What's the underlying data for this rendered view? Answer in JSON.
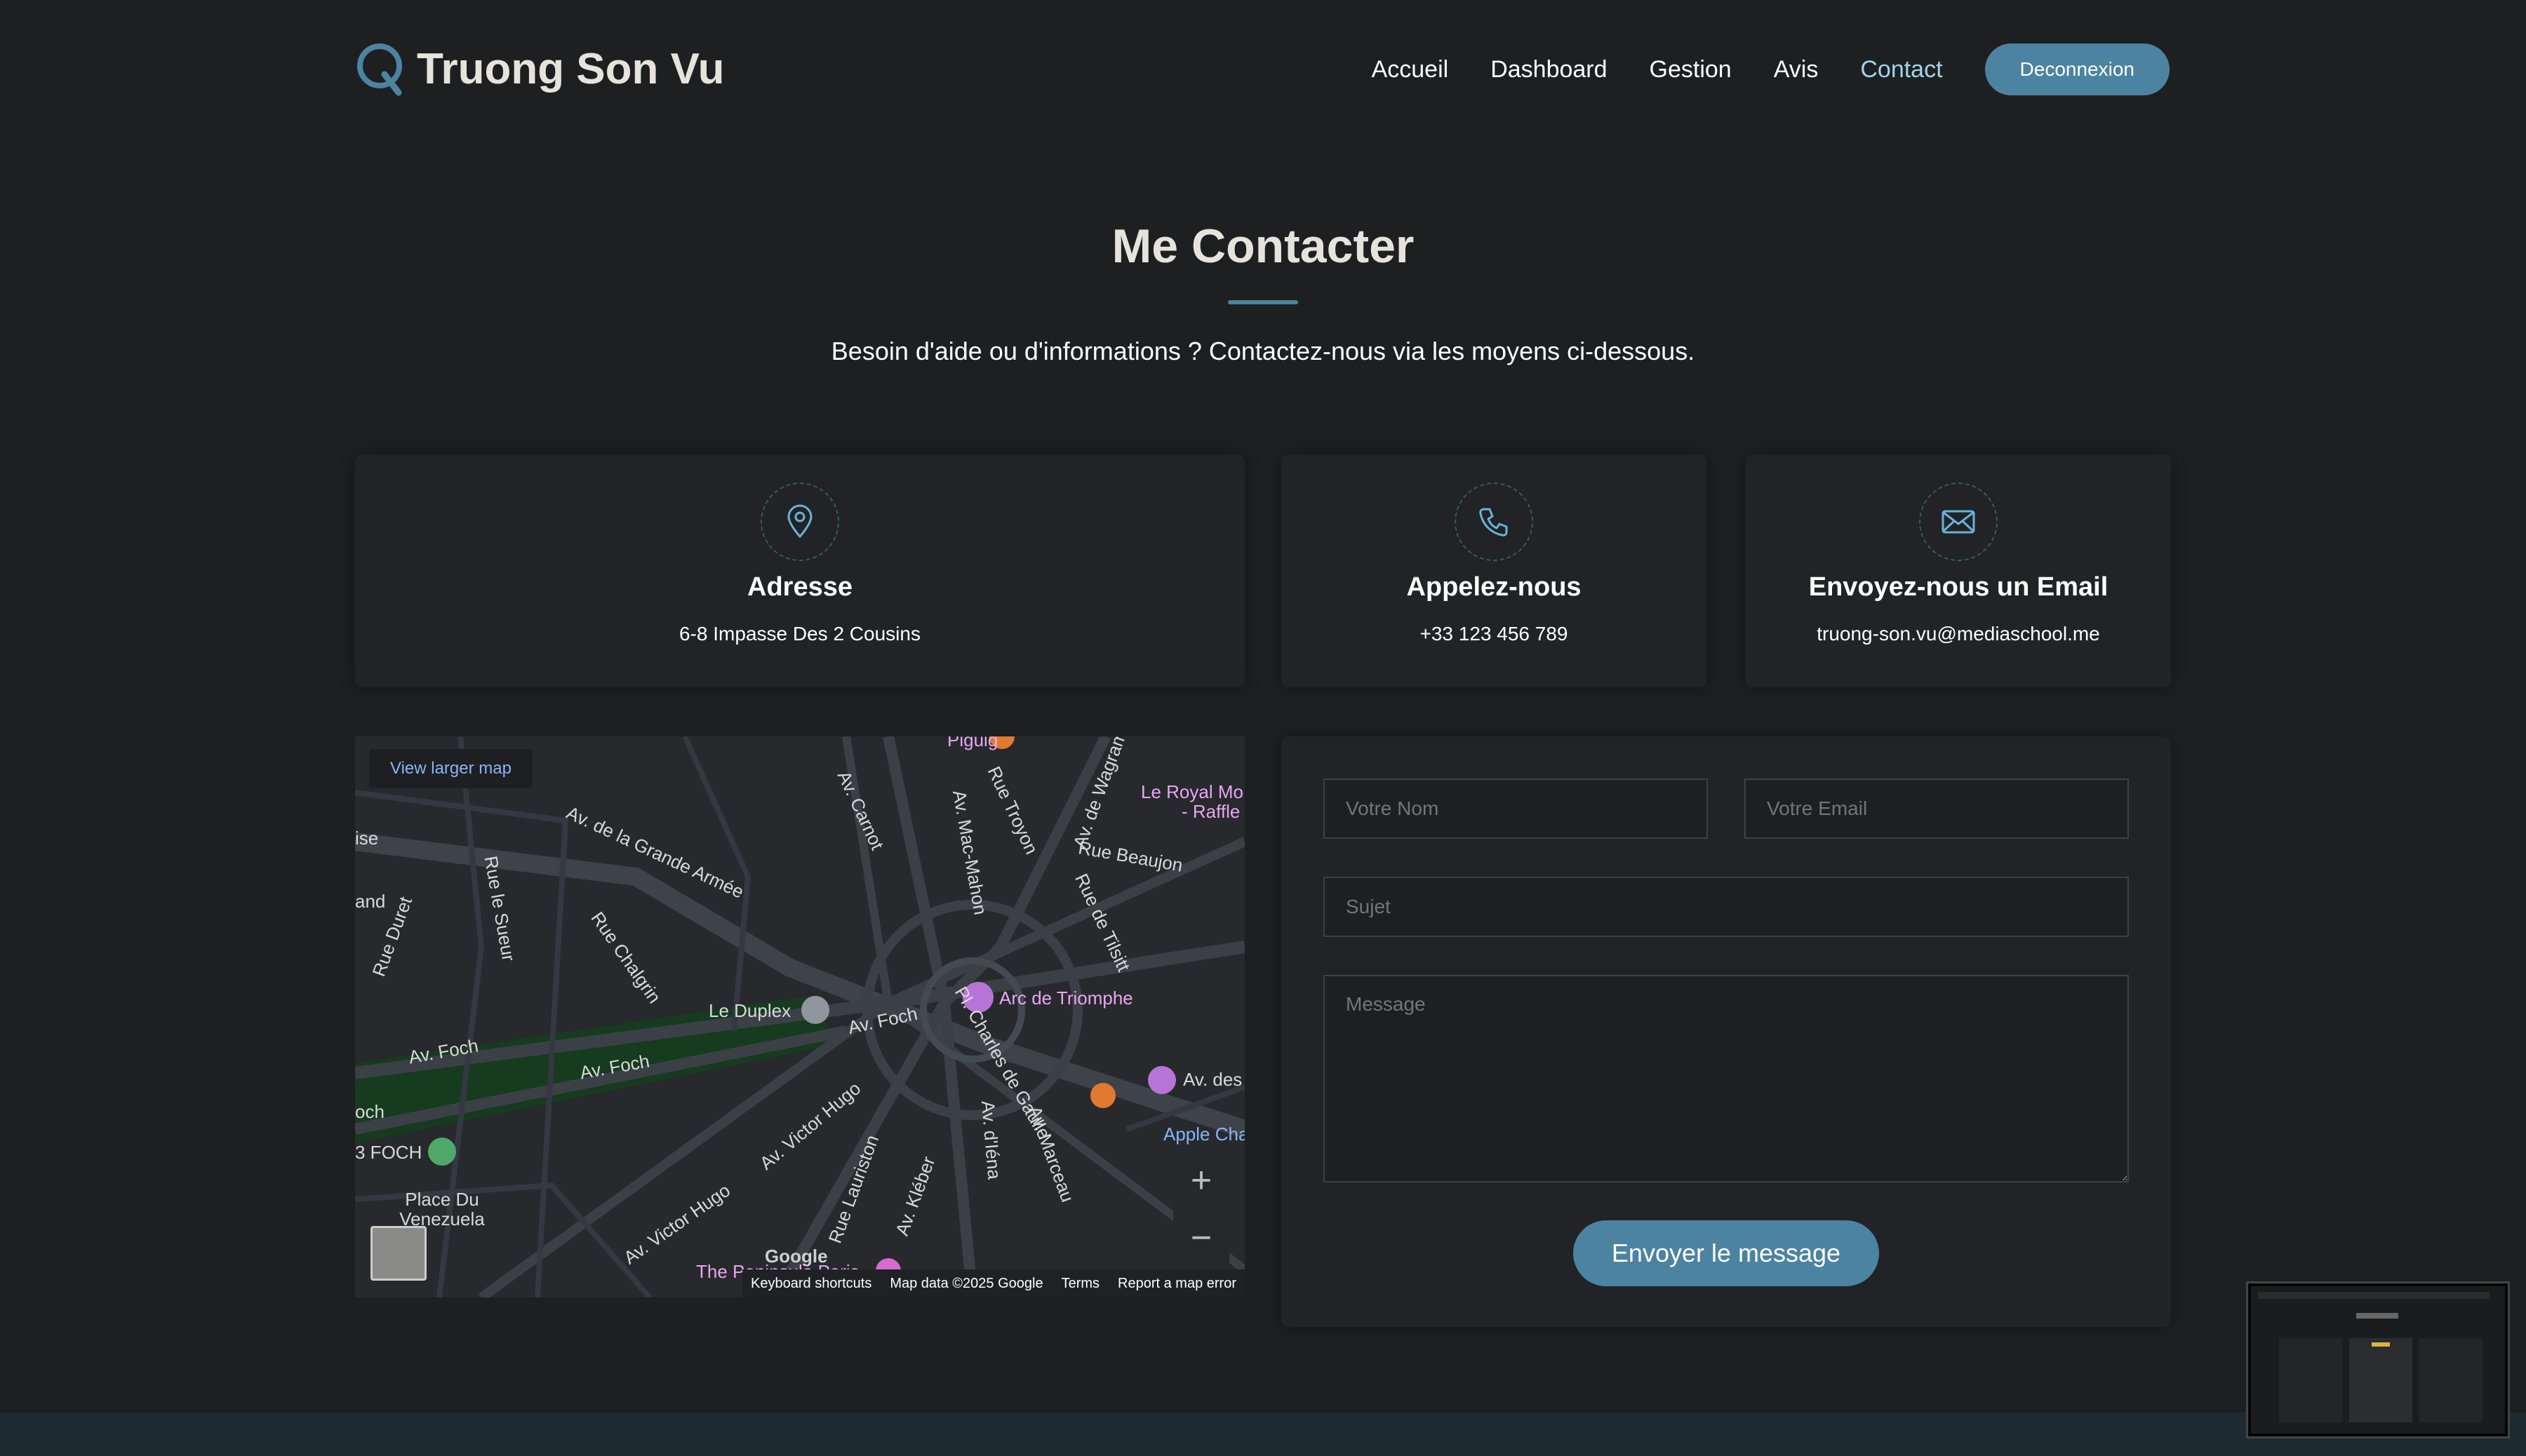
{
  "nav": {
    "brand": "Truong Son Vu",
    "items": [
      {
        "label": "Accueil",
        "active": false
      },
      {
        "label": "Dashboard",
        "active": false
      },
      {
        "label": "Gestion",
        "active": false
      },
      {
        "label": "Avis",
        "active": false
      },
      {
        "label": "Contact",
        "active": true
      }
    ],
    "logout_label": "Deconnexion"
  },
  "header": {
    "title": "Me Contacter",
    "subtitle": "Besoin d'aide ou d'informations ? Contactez-nous via les moyens ci-dessous."
  },
  "cards": [
    {
      "icon": "map-pin-icon",
      "title": "Adresse",
      "value": "6-8 Impasse Des 2 Cousins"
    },
    {
      "icon": "phone-icon",
      "title": "Appelez-nous",
      "value": "+33 123 456 789"
    },
    {
      "icon": "envelope-icon",
      "title": "Envoyez-nous un Email",
      "value": "truong-son.vu@mediaschool.me"
    }
  ],
  "map": {
    "link": "View larger map",
    "labels": [
      "Av. de la Grande Armée",
      "Rue Duret",
      "Rue le Sueur",
      "Rue Chalgrin",
      "Av. Carnot",
      "Av. Mac-Mahon",
      "Rue Troyon",
      "Av. de Wagram",
      "Rue Beaujon",
      "Rue de Tilsitt",
      "Le Duplex",
      "Arc de Triomphe",
      "Av. Foch",
      "Av. Foch",
      "Av. Foch",
      "Pl. Charles de Gaulle",
      "Av. Victor Hugo",
      "Av. Victor Hugo",
      "Rue Lauriston",
      "Av. Kléber",
      "Av. d'Iéna",
      "Av. Marceau",
      "Av. des",
      "Apple Cha",
      "3 FOCH",
      "Place Du Venezuela",
      "The Peninsula Paris",
      "Le Royal Mo",
      "- Raffle",
      "Piguig",
      "och",
      "and",
      "ise"
    ],
    "footer": [
      "Keyboard shortcuts",
      "Map data ©2025 Google",
      "Terms",
      "Report a map error"
    ],
    "logo": "Google"
  },
  "form": {
    "name_placeholder": "Votre Nom",
    "email_placeholder": "Votre Email",
    "subject_placeholder": "Sujet",
    "message_placeholder": "Message",
    "submit_label": "Envoyer le message"
  },
  "colors": {
    "background": "#1e1f21",
    "accent": "#4c83a0",
    "active_link": "#9fd4ec",
    "card": "#212326"
  }
}
